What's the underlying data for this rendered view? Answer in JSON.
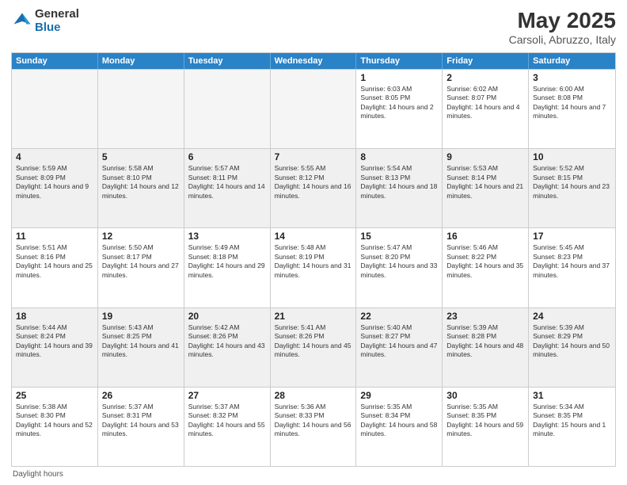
{
  "logo": {
    "general": "General",
    "blue": "Blue"
  },
  "title": "May 2025",
  "subtitle": "Carsoli, Abruzzo, Italy",
  "days_of_week": [
    "Sunday",
    "Monday",
    "Tuesday",
    "Wednesday",
    "Thursday",
    "Friday",
    "Saturday"
  ],
  "footer": "Daylight hours",
  "weeks": [
    [
      {
        "day": "",
        "empty": true
      },
      {
        "day": "",
        "empty": true
      },
      {
        "day": "",
        "empty": true
      },
      {
        "day": "",
        "empty": true
      },
      {
        "day": "1",
        "rise": "Sunrise: 6:03 AM",
        "set": "Sunset: 8:05 PM",
        "daylight": "Daylight: 14 hours and 2 minutes."
      },
      {
        "day": "2",
        "rise": "Sunrise: 6:02 AM",
        "set": "Sunset: 8:07 PM",
        "daylight": "Daylight: 14 hours and 4 minutes."
      },
      {
        "day": "3",
        "rise": "Sunrise: 6:00 AM",
        "set": "Sunset: 8:08 PM",
        "daylight": "Daylight: 14 hours and 7 minutes."
      }
    ],
    [
      {
        "day": "4",
        "rise": "Sunrise: 5:59 AM",
        "set": "Sunset: 8:09 PM",
        "daylight": "Daylight: 14 hours and 9 minutes."
      },
      {
        "day": "5",
        "rise": "Sunrise: 5:58 AM",
        "set": "Sunset: 8:10 PM",
        "daylight": "Daylight: 14 hours and 12 minutes."
      },
      {
        "day": "6",
        "rise": "Sunrise: 5:57 AM",
        "set": "Sunset: 8:11 PM",
        "daylight": "Daylight: 14 hours and 14 minutes."
      },
      {
        "day": "7",
        "rise": "Sunrise: 5:55 AM",
        "set": "Sunset: 8:12 PM",
        "daylight": "Daylight: 14 hours and 16 minutes."
      },
      {
        "day": "8",
        "rise": "Sunrise: 5:54 AM",
        "set": "Sunset: 8:13 PM",
        "daylight": "Daylight: 14 hours and 18 minutes."
      },
      {
        "day": "9",
        "rise": "Sunrise: 5:53 AM",
        "set": "Sunset: 8:14 PM",
        "daylight": "Daylight: 14 hours and 21 minutes."
      },
      {
        "day": "10",
        "rise": "Sunrise: 5:52 AM",
        "set": "Sunset: 8:15 PM",
        "daylight": "Daylight: 14 hours and 23 minutes."
      }
    ],
    [
      {
        "day": "11",
        "rise": "Sunrise: 5:51 AM",
        "set": "Sunset: 8:16 PM",
        "daylight": "Daylight: 14 hours and 25 minutes."
      },
      {
        "day": "12",
        "rise": "Sunrise: 5:50 AM",
        "set": "Sunset: 8:17 PM",
        "daylight": "Daylight: 14 hours and 27 minutes."
      },
      {
        "day": "13",
        "rise": "Sunrise: 5:49 AM",
        "set": "Sunset: 8:18 PM",
        "daylight": "Daylight: 14 hours and 29 minutes."
      },
      {
        "day": "14",
        "rise": "Sunrise: 5:48 AM",
        "set": "Sunset: 8:19 PM",
        "daylight": "Daylight: 14 hours and 31 minutes."
      },
      {
        "day": "15",
        "rise": "Sunrise: 5:47 AM",
        "set": "Sunset: 8:20 PM",
        "daylight": "Daylight: 14 hours and 33 minutes."
      },
      {
        "day": "16",
        "rise": "Sunrise: 5:46 AM",
        "set": "Sunset: 8:22 PM",
        "daylight": "Daylight: 14 hours and 35 minutes."
      },
      {
        "day": "17",
        "rise": "Sunrise: 5:45 AM",
        "set": "Sunset: 8:23 PM",
        "daylight": "Daylight: 14 hours and 37 minutes."
      }
    ],
    [
      {
        "day": "18",
        "rise": "Sunrise: 5:44 AM",
        "set": "Sunset: 8:24 PM",
        "daylight": "Daylight: 14 hours and 39 minutes."
      },
      {
        "day": "19",
        "rise": "Sunrise: 5:43 AM",
        "set": "Sunset: 8:25 PM",
        "daylight": "Daylight: 14 hours and 41 minutes."
      },
      {
        "day": "20",
        "rise": "Sunrise: 5:42 AM",
        "set": "Sunset: 8:26 PM",
        "daylight": "Daylight: 14 hours and 43 minutes."
      },
      {
        "day": "21",
        "rise": "Sunrise: 5:41 AM",
        "set": "Sunset: 8:26 PM",
        "daylight": "Daylight: 14 hours and 45 minutes."
      },
      {
        "day": "22",
        "rise": "Sunrise: 5:40 AM",
        "set": "Sunset: 8:27 PM",
        "daylight": "Daylight: 14 hours and 47 minutes."
      },
      {
        "day": "23",
        "rise": "Sunrise: 5:39 AM",
        "set": "Sunset: 8:28 PM",
        "daylight": "Daylight: 14 hours and 48 minutes."
      },
      {
        "day": "24",
        "rise": "Sunrise: 5:39 AM",
        "set": "Sunset: 8:29 PM",
        "daylight": "Daylight: 14 hours and 50 minutes."
      }
    ],
    [
      {
        "day": "25",
        "rise": "Sunrise: 5:38 AM",
        "set": "Sunset: 8:30 PM",
        "daylight": "Daylight: 14 hours and 52 minutes."
      },
      {
        "day": "26",
        "rise": "Sunrise: 5:37 AM",
        "set": "Sunset: 8:31 PM",
        "daylight": "Daylight: 14 hours and 53 minutes."
      },
      {
        "day": "27",
        "rise": "Sunrise: 5:37 AM",
        "set": "Sunset: 8:32 PM",
        "daylight": "Daylight: 14 hours and 55 minutes."
      },
      {
        "day": "28",
        "rise": "Sunrise: 5:36 AM",
        "set": "Sunset: 8:33 PM",
        "daylight": "Daylight: 14 hours and 56 minutes."
      },
      {
        "day": "29",
        "rise": "Sunrise: 5:35 AM",
        "set": "Sunset: 8:34 PM",
        "daylight": "Daylight: 14 hours and 58 minutes."
      },
      {
        "day": "30",
        "rise": "Sunrise: 5:35 AM",
        "set": "Sunset: 8:35 PM",
        "daylight": "Daylight: 14 hours and 59 minutes."
      },
      {
        "day": "31",
        "rise": "Sunrise: 5:34 AM",
        "set": "Sunset: 8:35 PM",
        "daylight": "Daylight: 15 hours and 1 minute."
      }
    ]
  ]
}
